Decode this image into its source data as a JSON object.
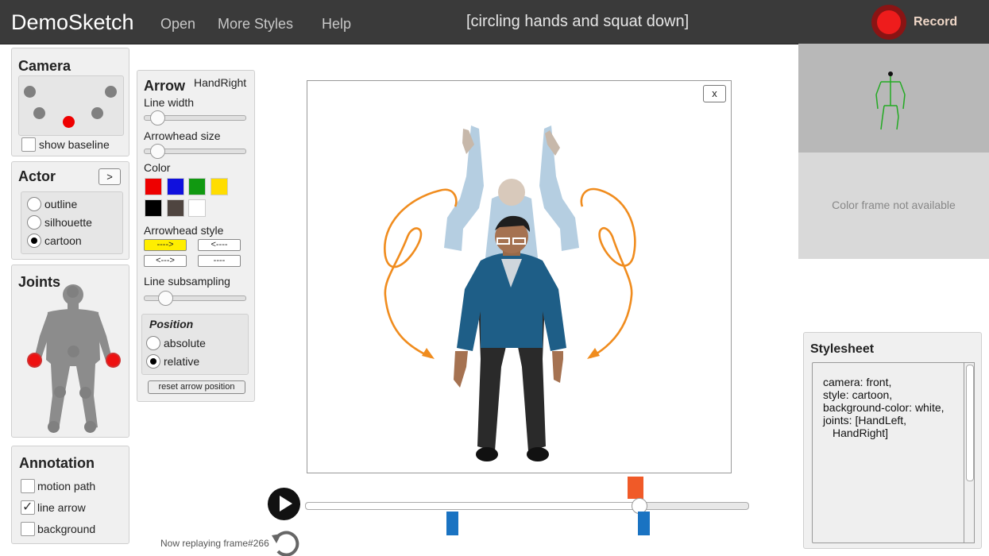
{
  "app": {
    "title": "DemoSketch"
  },
  "menu": {
    "open": "Open",
    "more_styles": "More Styles",
    "help": "Help"
  },
  "caption": "[circling hands and squat down]",
  "record": {
    "label": "Record"
  },
  "camera": {
    "title": "Camera",
    "show_baseline": "show baseline",
    "selected_index": 4
  },
  "actor": {
    "title": "Actor",
    "next_label": ">",
    "options": [
      "outline",
      "silhouette",
      "cartoon"
    ],
    "selected": "cartoon"
  },
  "joints": {
    "title": "Joints",
    "selected": [
      "HandLeft",
      "HandRight"
    ]
  },
  "annotation": {
    "title": "Annotation",
    "motion_path": "motion path",
    "line_arrow": "line arrow",
    "background": "background",
    "line_arrow_checked": true
  },
  "arrow": {
    "title": "Arrow",
    "joint": "HandRight",
    "line_width_label": "Line width",
    "arrowhead_size_label": "Arrowhead size",
    "color_label": "Color",
    "colors": [
      "#ee0000",
      "#1010dd",
      "#119911",
      "#ffdd00",
      "#000000",
      "#4f4540",
      "#ffffff"
    ],
    "arrowhead_style_label": "Arrowhead style",
    "styles": [
      "---->",
      "<----",
      "<--->",
      "----"
    ],
    "selected_style": "---->",
    "line_subsampling_label": "Line subsampling",
    "position_label": "Position",
    "absolute": "absolute",
    "relative": "relative",
    "position_selected": "relative",
    "reset_label": "reset arrow position",
    "line_width_value": 0.1,
    "arrowhead_size_value": 0.1,
    "line_subsampling_value": 0.2
  },
  "canvas": {
    "close": "x"
  },
  "playback": {
    "status": "Now replaying frame#266",
    "progress": 0.75
  },
  "preview": {
    "unavailable": "Color frame not available"
  },
  "stylesheet": {
    "title": "Stylesheet",
    "lines": [
      "camera: front,",
      "style: cartoon,",
      "background-color: white,",
      "joints: [HandLeft,",
      "HandRight]"
    ]
  },
  "accent": {
    "orange": "#f08c1e",
    "record": "#ee1c1c",
    "highlight": "#ffee00"
  }
}
